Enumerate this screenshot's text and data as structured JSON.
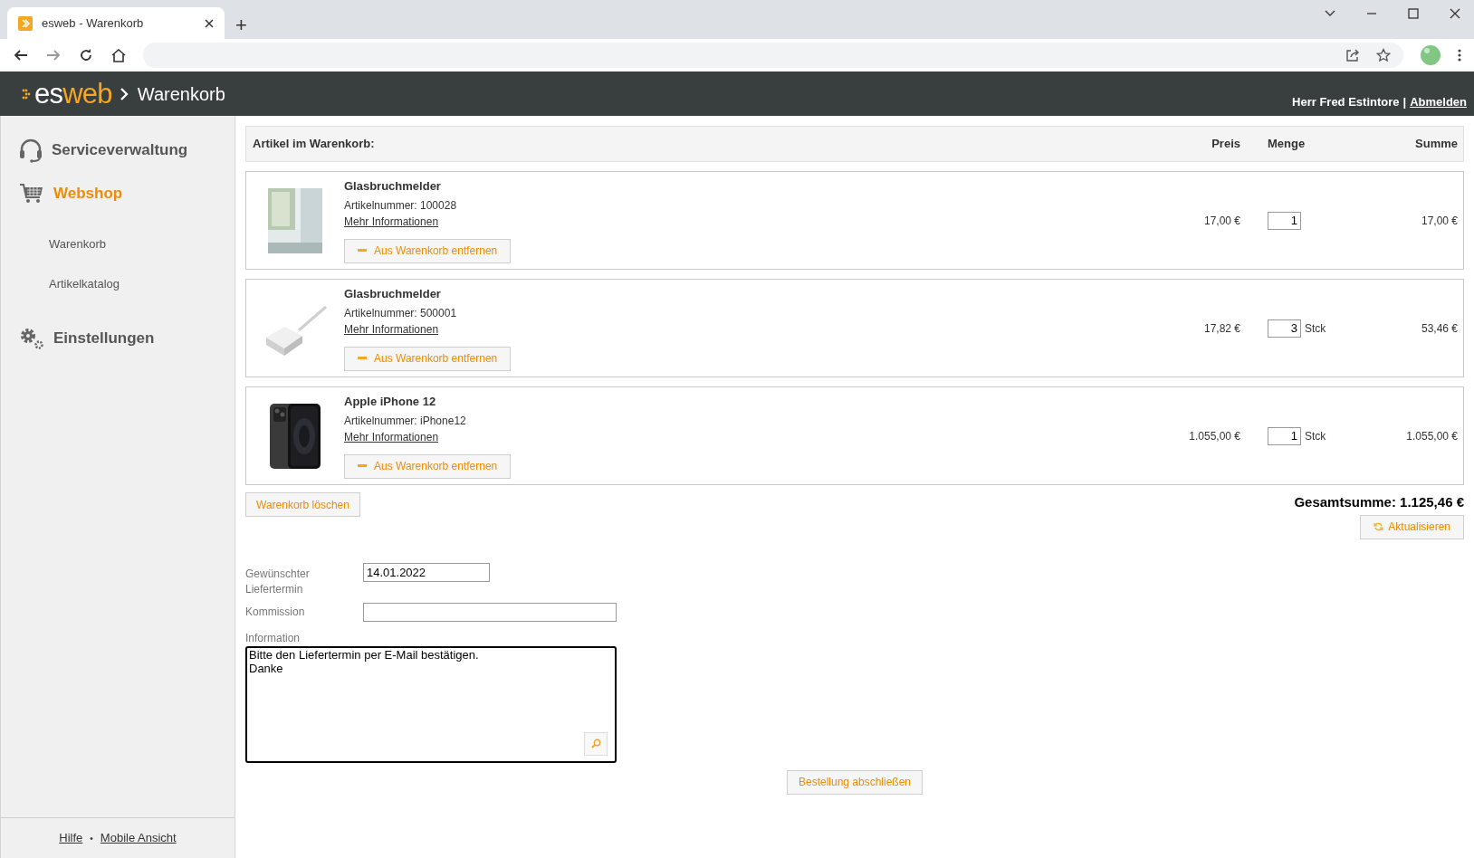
{
  "browser": {
    "tab_title": "esweb - Warenkorb",
    "new_tab": "+"
  },
  "header": {
    "logo_left": "es",
    "logo_right": "web",
    "breadcrumb": "Warenkorb",
    "user": "Herr Fred Estintore",
    "separator": "|",
    "logout": "Abmelden"
  },
  "sidebar": {
    "items": [
      {
        "label": "Serviceverwaltung",
        "kind": "section",
        "selected": false
      },
      {
        "label": "Webshop",
        "kind": "section",
        "selected": true
      },
      {
        "label": "Warenkorb",
        "kind": "sub",
        "selected": false
      },
      {
        "label": "Artikelkatalog",
        "kind": "sub",
        "selected": false
      },
      {
        "label": "Einstellungen",
        "kind": "section",
        "selected": false
      }
    ],
    "footer": {
      "help": "Hilfe",
      "dot": "•",
      "mobile": "Mobile Ansicht"
    }
  },
  "cart": {
    "columns": [
      "Artikel im Warenkorb:",
      "Preis",
      "Menge",
      "Summe"
    ],
    "items": [
      {
        "name": "Glasbruchmelder",
        "number": "Artikelnummer: 100028",
        "link": "Mehr Informationen",
        "remove": "Aus Warenkorb entfernen",
        "price": "17,00 €",
        "quantity": "1",
        "total": "17,00 €"
      },
      {
        "name": "Glasbruchmelder",
        "number": "Artikelnummer: 500001",
        "link": "Mehr Informationen",
        "remove": "Aus Warenkorb entfernen",
        "price": "17,82 €",
        "quantity": "3",
        "unit": "Stck",
        "total": "53,46 €"
      },
      {
        "name": "Apple iPhone 12",
        "number": "Artikelnummer: iPhone12",
        "link": "Mehr Informationen",
        "remove": "Aus Warenkorb entfernen",
        "price": "1.055,00 €",
        "quantity": "1",
        "unit": "Stck",
        "total": "1.055,00 €"
      }
    ],
    "clear": "Warenkorb löschen",
    "grand_total": "Gesamtsumme: 1.125,46 €",
    "update": "Aktualisieren"
  },
  "form": {
    "delivery_label": "Gewünschter Liefertermin",
    "delivery_value": "14.01.2022",
    "commission_label": "Kommission",
    "info_label": "Information",
    "info_value": "Bitte den Liefertermin per E-Mail bestätigen.\nDanke",
    "submit": "Bestellung abschließen"
  }
}
